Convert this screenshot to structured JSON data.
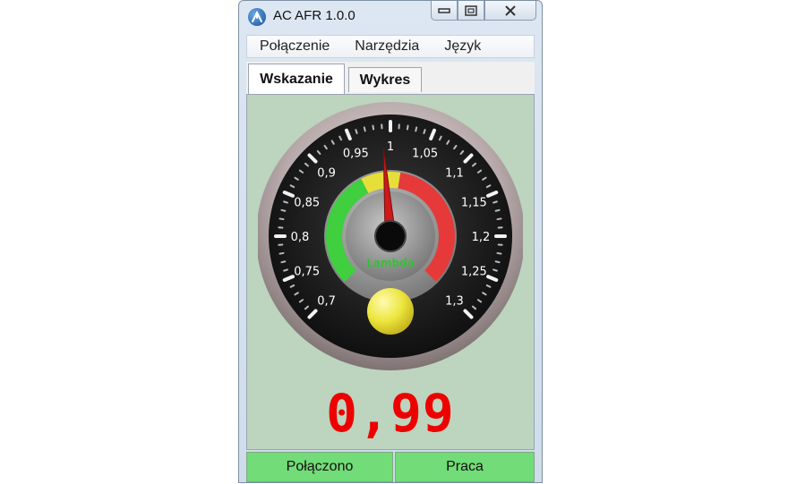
{
  "window": {
    "title": "AC AFR   1.0.0"
  },
  "menu": [
    "Połączenie",
    "Narzędzia",
    "Język"
  ],
  "tabs": [
    {
      "label": "Wskazanie",
      "active": true
    },
    {
      "label": "Wykres",
      "active": false
    }
  ],
  "gauge": {
    "scale_labels": [
      "0,7",
      "0,75",
      "0,8",
      "0,85",
      "0,9",
      "0,95",
      "1",
      "1,05",
      "1,1",
      "1,15",
      "1,2",
      "1,25",
      "1,3"
    ],
    "min": 0.7,
    "max": 1.3,
    "value": 0.99,
    "unit_label": "Lambda",
    "bands": [
      {
        "from": 0.7,
        "to": 0.94,
        "color": "#3fcf3f"
      },
      {
        "from": 0.94,
        "to": 1.02,
        "color": "#e6df3a"
      },
      {
        "from": 1.02,
        "to": 1.3,
        "color": "#e63a3a"
      }
    ],
    "indicator_color": "#e8e43a"
  },
  "reading": {
    "value": "0,99"
  },
  "status": {
    "left": "Połączono",
    "right": "Praca"
  },
  "colors": {
    "panel": "#bdd4bf",
    "reading": "#ee0000",
    "status": "#72dc78",
    "needle": "#cc1a1a"
  }
}
